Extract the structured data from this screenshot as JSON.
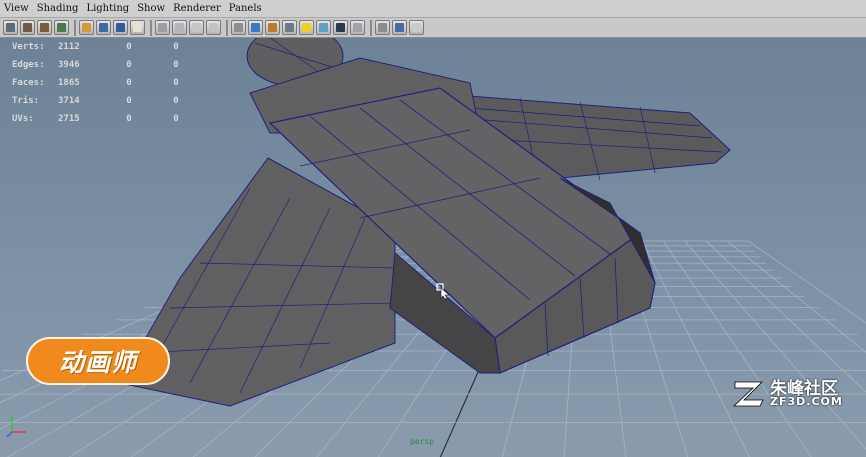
{
  "menu": [
    "View",
    "Shading",
    "Lighting",
    "Show",
    "Renderer",
    "Panels"
  ],
  "toolbar": {
    "icons": [
      {
        "name": "select-camera-icon",
        "color": "#5a6b7a"
      },
      {
        "name": "lock-camera-icon",
        "color": "#6e5a4a"
      },
      {
        "name": "camera-attributes-icon",
        "color": "#7a5a3a"
      },
      {
        "name": "bookmark-icon",
        "color": "#4a7a4a"
      },
      {
        "sep": true
      },
      {
        "name": "image-plane-icon",
        "color": "#d49a3a"
      },
      {
        "name": "two-d-pan-zoom-icon",
        "color": "#3a6aa8"
      },
      {
        "name": "grease-pencil-icon",
        "color": "#2f5ea0"
      },
      {
        "name": "film-gate-icon",
        "color": "#e8e2d0"
      },
      {
        "sep": true
      },
      {
        "name": "resolution-gate-icon",
        "color": "#9aa0a8"
      },
      {
        "name": "gate-mask-icon",
        "color": "#b0b6bc"
      },
      {
        "name": "field-chart-icon",
        "color": "#c4c8cc"
      },
      {
        "name": "safe-action-icon",
        "color": "#c0c4c8"
      },
      {
        "sep": true
      },
      {
        "name": "wireframe-icon",
        "color": "#8a8f96"
      },
      {
        "name": "smooth-shade-icon",
        "color": "#3a78c2"
      },
      {
        "name": "textured-icon",
        "color": "#c07a2a"
      },
      {
        "name": "use-default-material-icon",
        "color": "#6a7a8a"
      },
      {
        "name": "lights-icon",
        "color": "#f0d020"
      },
      {
        "name": "shadows-icon",
        "color": "#5aa0c8"
      },
      {
        "name": "screen-space-ao-icon",
        "color": "#2a3a4a"
      },
      {
        "name": "motion-blur-icon",
        "color": "#a0a4aa"
      },
      {
        "sep": true
      },
      {
        "name": "isolate-select-icon",
        "color": "#8a8e94"
      },
      {
        "name": "xray-icon",
        "color": "#4a68a8"
      },
      {
        "name": "xray-joints-icon",
        "color": "#c8ccd0"
      }
    ]
  },
  "hud": [
    {
      "label": "Verts:",
      "value": "2112",
      "sel": "0",
      "comp": "0"
    },
    {
      "label": "Edges:",
      "value": "3946",
      "sel": "0",
      "comp": "0"
    },
    {
      "label": "Faces:",
      "value": "1865",
      "sel": "0",
      "comp": "0"
    },
    {
      "label": "Tris:",
      "value": "3714",
      "sel": "0",
      "comp": "0"
    },
    {
      "label": "UVs:",
      "value": "2715",
      "sel": "0",
      "comp": "0"
    }
  ],
  "viewport": {
    "camera_label": "persp",
    "model_color": "#5c5c5e",
    "wire_color": "#25217a",
    "grid_color": "#a7b3c2"
  },
  "watermark_left": {
    "text": "动画师"
  },
  "watermark_right": {
    "title": "朱峰社区",
    "url": "ZF3D.COM"
  }
}
